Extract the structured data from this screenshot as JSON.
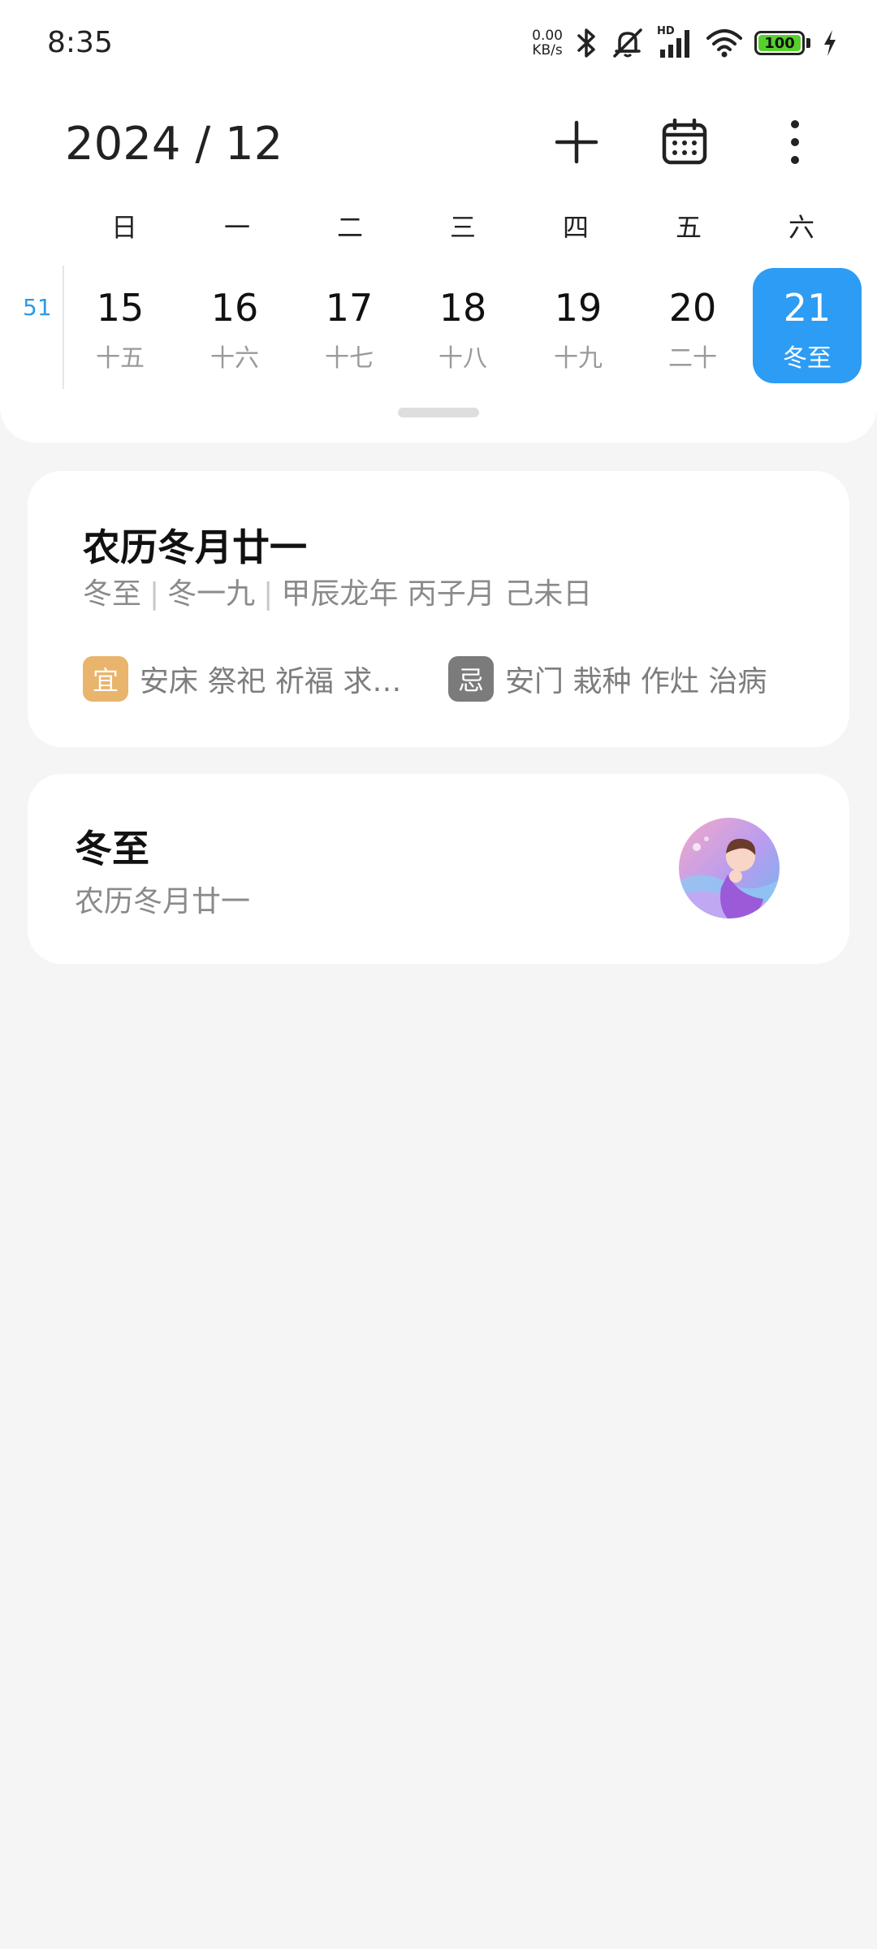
{
  "status_bar": {
    "time": "8:35",
    "net_speed_value": "0.00",
    "net_speed_unit": "KB/s",
    "signal_label": "HD",
    "battery_level": "100",
    "battery_fill_percent": 100,
    "icons": [
      "bluetooth-icon",
      "mute-icon",
      "signal-icon",
      "wifi-icon",
      "battery-icon",
      "charging-icon"
    ]
  },
  "header": {
    "title": "2024 / 12",
    "actions": [
      "add-icon",
      "calendar-icon",
      "more-icon"
    ]
  },
  "weekdays": [
    "日",
    "一",
    "二",
    "三",
    "四",
    "五",
    "六"
  ],
  "week": {
    "number": "51",
    "days": [
      {
        "day": "15",
        "lunar": "十五",
        "selected": false
      },
      {
        "day": "16",
        "lunar": "十六",
        "selected": false
      },
      {
        "day": "17",
        "lunar": "十七",
        "selected": false
      },
      {
        "day": "18",
        "lunar": "十八",
        "selected": false
      },
      {
        "day": "19",
        "lunar": "十九",
        "selected": false
      },
      {
        "day": "20",
        "lunar": "二十",
        "selected": false
      },
      {
        "day": "21",
        "lunar": "冬至",
        "selected": true
      }
    ]
  },
  "lunar_card": {
    "title": "农历冬月廿一",
    "sub_parts": [
      "冬至",
      "冬一九",
      "甲辰龙年 丙子月 己未日"
    ],
    "yi_badge": "宜",
    "yi_text": "安床 祭祀 祈福 求…",
    "ji_badge": "忌",
    "ji_text": "安门 栽种 作灶 治病"
  },
  "holiday_card": {
    "title": "冬至",
    "subtitle": "农历冬月廿一"
  },
  "colors": {
    "accent": "#2d9cf4",
    "week_number": "#2e9be6",
    "yi_badge": "#e9b46c",
    "ji_badge": "#7b7b7b",
    "background": "#f5f5f5",
    "battery": "#56d12c"
  }
}
